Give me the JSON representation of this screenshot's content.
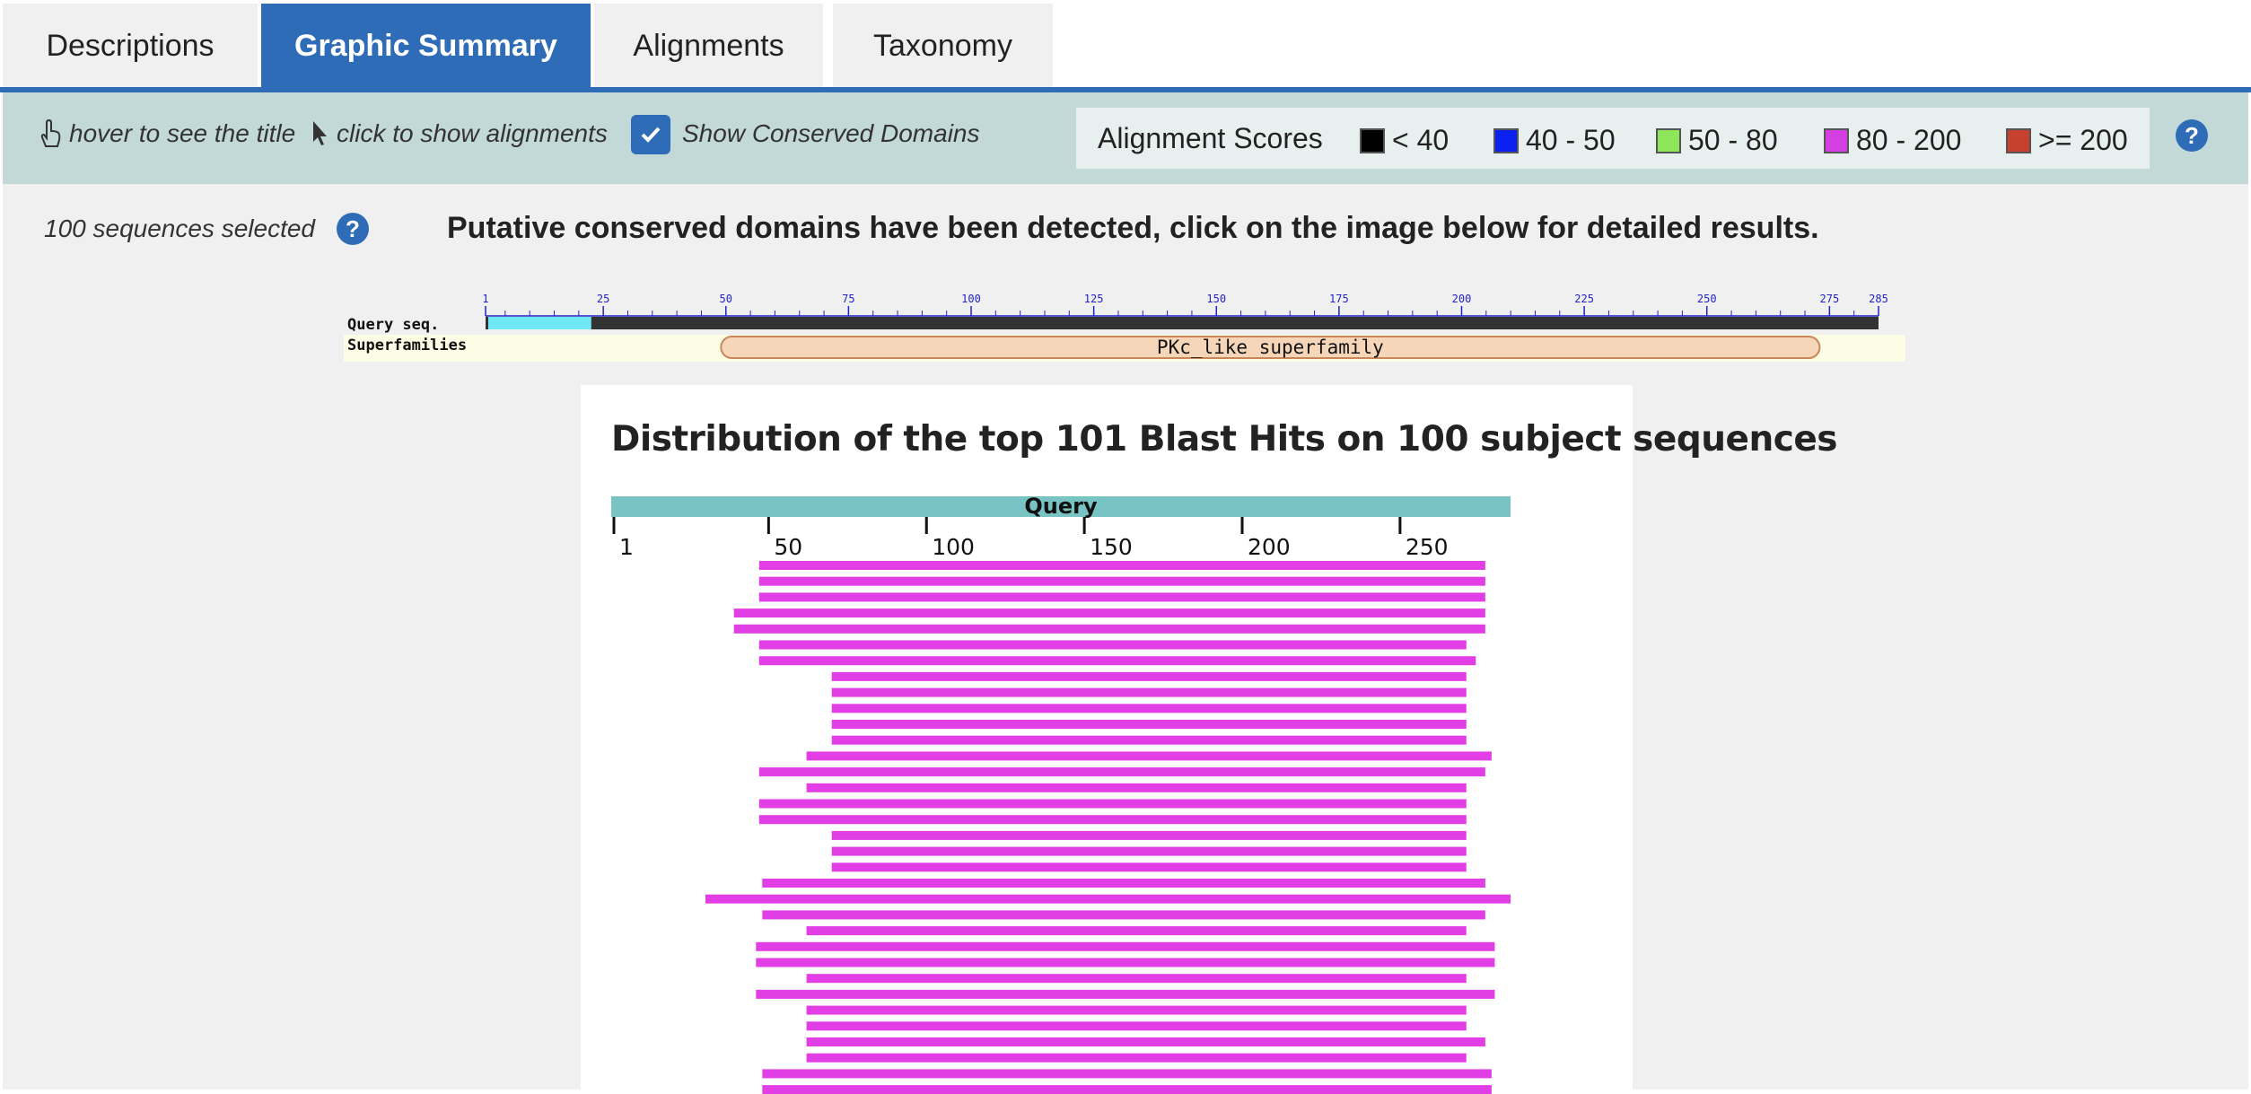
{
  "tabs": [
    {
      "label": "Descriptions",
      "active": false
    },
    {
      "label": "Graphic Summary",
      "active": true
    },
    {
      "label": "Alignments",
      "active": false
    },
    {
      "label": "Taxonomy",
      "active": false
    }
  ],
  "toolbar": {
    "hover_hint": "hover to see the title",
    "click_hint": "click to show alignments",
    "show_cd_label": "Show Conserved Domains",
    "show_cd_checked": true,
    "legend_title": "Alignment Scores",
    "legend": [
      {
        "label": "< 40",
        "color": "#000000"
      },
      {
        "label": "40 - 50",
        "color": "#0a21f0"
      },
      {
        "label": "50 - 80",
        "color": "#8ee65a"
      },
      {
        "label": "80 - 200",
        "color": "#d33fe0"
      },
      {
        "label": ">= 200",
        "color": "#c8402e"
      }
    ]
  },
  "main": {
    "sequences_selected": "100 sequences selected",
    "cd_message": "Putative conserved domains have been detected, click on the image below for detailed results."
  },
  "cd_graphic": {
    "row_labels": [
      "Query seq.",
      "Superfamilies"
    ],
    "ticks": [
      1,
      25,
      50,
      75,
      100,
      125,
      150,
      175,
      200,
      225,
      250,
      275,
      285
    ],
    "query_length": 285,
    "highlight_range": [
      1,
      22
    ],
    "domain": {
      "label": "PKc_like superfamily",
      "start": 49,
      "end": 273
    }
  },
  "distribution": {
    "title": "Distribution of the top 101 Blast Hits on 100 subject sequences",
    "query_label": "Query",
    "query_length": 285,
    "ticks": [
      1,
      50,
      100,
      150,
      200,
      250
    ],
    "hit_color": "#e23ee6",
    "query_bar_color": "#78c3c3",
    "hits": [
      [
        47,
        277
      ],
      [
        47,
        277
      ],
      [
        47,
        277
      ],
      [
        39,
        277
      ],
      [
        39,
        277
      ],
      [
        47,
        271
      ],
      [
        47,
        274
      ],
      [
        70,
        271
      ],
      [
        70,
        271
      ],
      [
        70,
        271
      ],
      [
        70,
        271
      ],
      [
        70,
        271
      ],
      [
        62,
        279
      ],
      [
        47,
        277
      ],
      [
        62,
        271
      ],
      [
        47,
        271
      ],
      [
        47,
        271
      ],
      [
        70,
        271
      ],
      [
        70,
        271
      ],
      [
        70,
        271
      ],
      [
        48,
        277
      ],
      [
        30,
        285
      ],
      [
        48,
        277
      ],
      [
        62,
        271
      ],
      [
        46,
        280
      ],
      [
        46,
        280
      ],
      [
        62,
        271
      ],
      [
        46,
        280
      ],
      [
        62,
        271
      ],
      [
        62,
        271
      ],
      [
        62,
        277
      ],
      [
        62,
        271
      ],
      [
        48,
        279
      ],
      [
        48,
        279
      ]
    ]
  }
}
